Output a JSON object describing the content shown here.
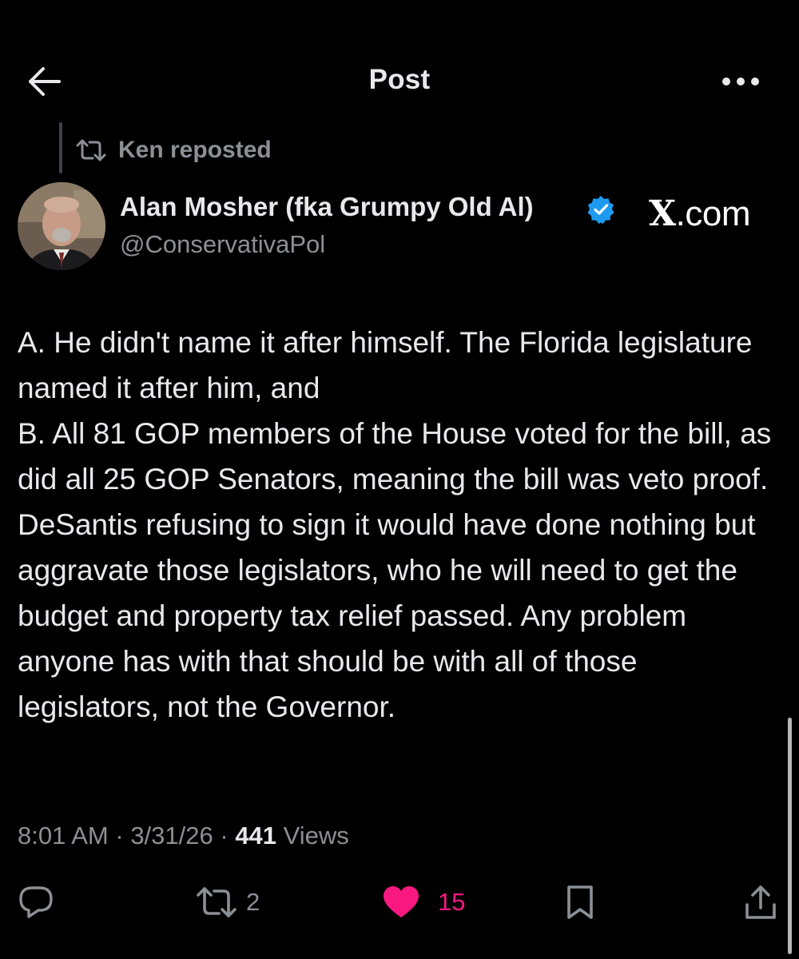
{
  "header": {
    "title": "Post"
  },
  "repost": {
    "label": "Ken reposted"
  },
  "author": {
    "name": "Alan Mosher (fka Grumpy Old Al)",
    "handle": "@ConservativaPol",
    "verified": true
  },
  "watermark": {
    "text": ".com",
    "glyph": "X"
  },
  "post": {
    "text": "A. He didn't name it after himself.  The Florida legislature named it after him, and\nB. All 81 GOP members of the House voted for the bill, as did all 25 GOP Senators, meaning the bill was veto proof.  DeSantis refusing to sign it would have done nothing but aggravate those legislators, who he will need to get the budget and property tax relief passed.  Any problem anyone has with that should be with all of those legislators, not the Governor."
  },
  "meta": {
    "time": "8:01 AM",
    "sep": " · ",
    "date": "3/31/26",
    "sep2": " · ",
    "views_count": "441",
    "views_label": " Views"
  },
  "actions": {
    "reply_count": "",
    "repost_count": "2",
    "like_count": "15",
    "liked": true
  },
  "colors": {
    "background": "#000000",
    "text": "#e7e9ea",
    "muted": "#8b9095",
    "verified": "#1d9bf0",
    "like": "#f91880"
  },
  "icons": {
    "back": "arrow-left-icon",
    "more": "more-horizontal-icon",
    "repost": "repost-icon",
    "verified": "verified-badge-icon",
    "reply": "reply-icon",
    "like": "heart-filled-icon",
    "bookmark": "bookmark-icon",
    "share": "share-icon"
  }
}
